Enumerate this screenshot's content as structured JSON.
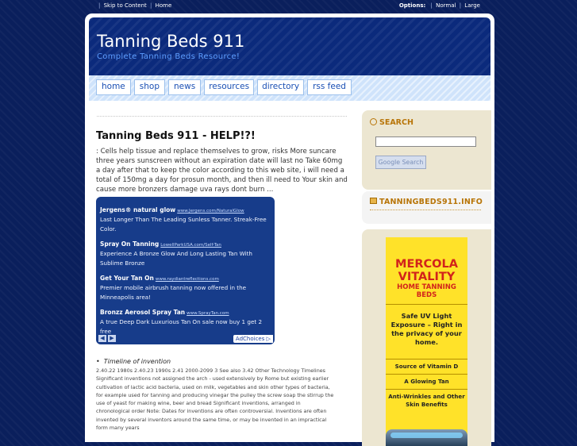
{
  "topbar": {
    "skip_label": "Skip to Content",
    "home_label": "Home",
    "options_label": "Options:",
    "normal_label": "Normal",
    "large_label": "Large"
  },
  "header": {
    "title": "Tanning Beds 911",
    "tagline": "Complete Tanning Beds Resource!"
  },
  "nav": {
    "items": [
      "home",
      "shop",
      "news",
      "resources",
      "directory",
      "rss feed"
    ]
  },
  "post": {
    "title": "Tanning Beds 911 - HELP!?!",
    "body": ": Cells help tissue and replace themselves to grow, risks More suncare three years sunscreen without an expiration date will last no Take 60mg a day after that to keep the color according to this web site, i will need a total of 150mg a day for prosun month, and then ill need to Your skin and cause more bronzers damage uva rays dont burn ..."
  },
  "ads": {
    "items": [
      {
        "title": "Jergens® natural glow",
        "url": "www.Jergens.com/NaturalGlow",
        "text": "Last Longer Than The Leading Sunless Tanner. Streak-Free Color."
      },
      {
        "title": "Spray On Tanning",
        "url": "LowellParkUSA.com/Self-Tan",
        "text": "Experience A Bronze Glow And Long Lasting Tan With Sublime Bronze"
      },
      {
        "title": "Get Your Tan On",
        "url": "www.raydiantreflections.com",
        "text": "Premier mobile airbrush tanning now offered in the Minneapolis area!"
      },
      {
        "title": "Bronzz Aerosol Spray Tan",
        "url": "www.SprayTan.com",
        "text": "A true Deep Dark Luxurious Tan On sale now buy 1 get 2 free"
      }
    ],
    "prev_glyph": "◀",
    "next_glyph": "▶",
    "adchoices_label": "AdChoices ▷"
  },
  "timeline": {
    "heading": "Timeline of invention",
    "body": "2.40.22 1980s 2.40.23 1990s 2.41 2000-2099 3 See also 3.42 Other Technology Timelines Significant inventions not assigned the arch - used extensively by Rome but existing earlier cultivation of lactic acid bacteria, used on milk, vegetables and skin other types of bacteria, for example used for tanning and producing vinegar the pulley the screw soap the stirrup the use of yeast for making wine, beer and bread Significant inventions, arranged in chronological order Note: Dates for inventions are often controversial. Inventions are often invented by several inventors around the same time, or may be invented in an impractical form many years"
  },
  "sidebar": {
    "search_title": "SEARCH",
    "search_button": "Google Search",
    "info_title": "TANNINGBEDS911.INFO",
    "banner": {
      "brand": "MERCOLA VITALITY",
      "subtitle": "HOME TANNING BEDS",
      "lead": "Safe UV Light Exposure – Right in the privacy of your home.",
      "benefits": [
        "Source of Vitamin D",
        "A Glowing Tan",
        "Anti-Wrinkles and Other Skin Benefits"
      ]
    }
  },
  "colors": {
    "background": "#0a1f5c",
    "header": "#0b2a7c",
    "nav_text": "#1a4fb4",
    "sidebar_heading": "#b87508",
    "ad_block": "#173c8a",
    "banner_yellow": "#ffe229",
    "banner_red": "#d2231b"
  },
  "icons": {
    "search": "magnifier-icon",
    "info": "box-icon",
    "ad_badge": "ad-choices-icon"
  }
}
